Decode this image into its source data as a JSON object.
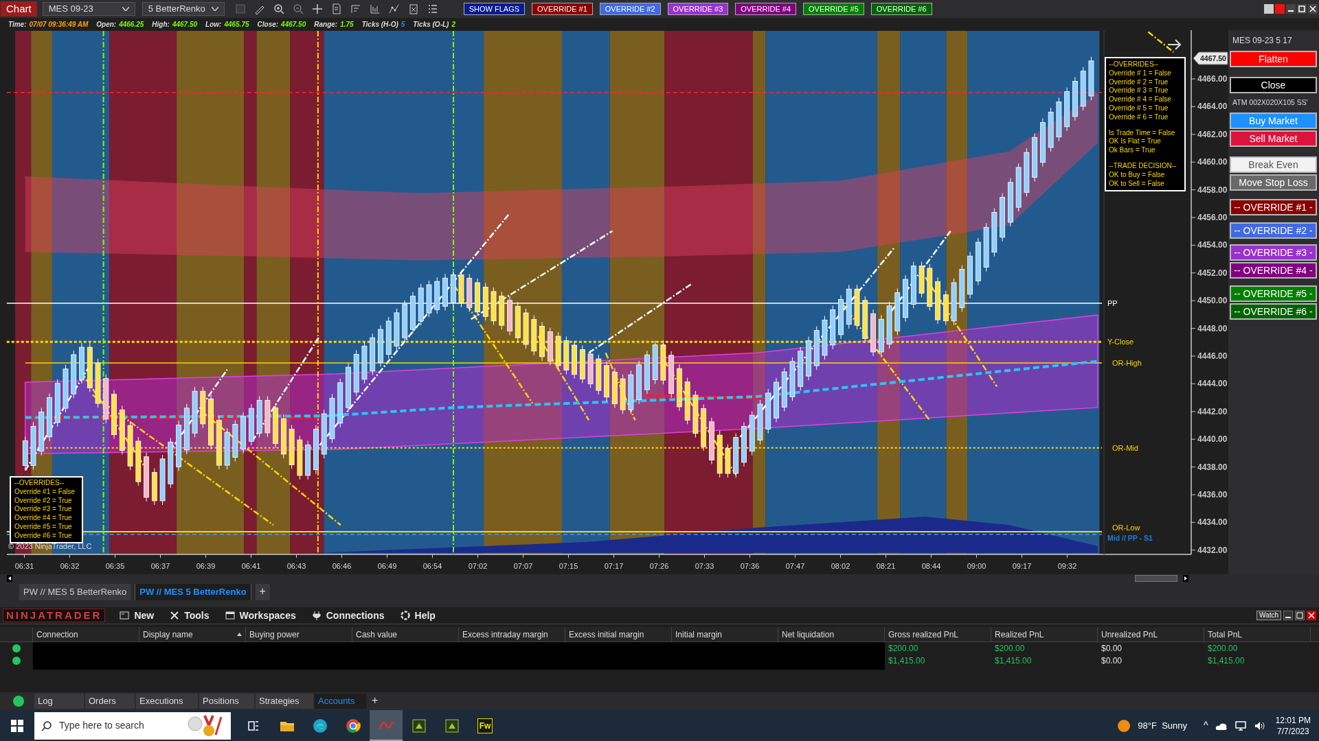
{
  "toolbar": {
    "chart_button": "Chart",
    "instrument": "MES 09-23",
    "bar_type": "5 BetterRenko",
    "flag_buttons": [
      {
        "label": "SHOW FLAGS",
        "color": "#0b1a8f"
      },
      {
        "label": "OVERRIDE #1",
        "color": "#8b0000"
      },
      {
        "label": "OVERRIDE #2",
        "color": "#4169e1"
      },
      {
        "label": "OVERRIDE #3",
        "color": "#9932cc"
      },
      {
        "label": "OVERRIDE #4",
        "color": "#800080"
      },
      {
        "label": "OVERRIDE #5",
        "color": "#008000"
      },
      {
        "label": "OVERRIDE #6",
        "color": "#006400"
      }
    ]
  },
  "data_line": [
    {
      "label": "Time:",
      "value": "07/07 09:36:49 AM",
      "color": "#ffa500"
    },
    {
      "label": "Open:",
      "value": "4466.25",
      "color": "#7cfc00"
    },
    {
      "label": "High:",
      "value": "4467.50",
      "color": "#7cfc00"
    },
    {
      "label": "Low:",
      "value": "4465.75",
      "color": "#7cfc00"
    },
    {
      "label": "Close:",
      "value": "4467.50",
      "color": "#7cfc00"
    },
    {
      "label": "Range:",
      "value": "1.75",
      "color": "#7cfc00"
    },
    {
      "label": "Ticks (H-O)",
      "value": "5",
      "color": "#1e90ff"
    },
    {
      "label": "Ticks (O-L)",
      "value": "2",
      "color": "#7cfc00"
    }
  ],
  "chart": {
    "price_ticks": [
      "4466.00",
      "4464.00",
      "4462.00",
      "4460.00",
      "4458.00",
      "4456.00",
      "4454.00",
      "4452.00",
      "4450.00",
      "4448.00",
      "4446.00",
      "4444.00",
      "4442.00",
      "4440.00",
      "4438.00",
      "4436.00",
      "4434.00",
      "4432.00"
    ],
    "current_price": "4467.50",
    "time_ticks": [
      "06:31",
      "06:32",
      "06:35",
      "06:37",
      "06:39",
      "06:41",
      "06:43",
      "06:46",
      "06:49",
      "06:54",
      "07:02",
      "07:07",
      "07:15",
      "07:17",
      "07:26",
      "07:33",
      "07:36",
      "07:47",
      "08:02",
      "08:21",
      "08:44",
      "09:00",
      "09:17",
      "09:32"
    ],
    "level_labels": [
      {
        "text": "PP",
        "color": "#ffffff"
      },
      {
        "text": "Y-Close",
        "color": "#ffd700"
      },
      {
        "text": "OR-High",
        "color": "#ffd700"
      },
      {
        "text": "OR-Mid",
        "color": "#ffd700"
      },
      {
        "text": "OR-Low",
        "color": "#ffd700"
      },
      {
        "text": "Mid // PP - S1",
        "color": "#1e7ee0"
      }
    ],
    "overrides_panel": [
      {
        "lines": [
          "--OVERRIDES--",
          "Override # 1  = False",
          "Override # 2  = True",
          "Override # 3  = True",
          "Override # 4  = False",
          "Override # 5  = True",
          "Override # 6  = True"
        ]
      },
      {
        "lines": [
          "Is Trade Time = False",
          "OK Is Flat = True",
          "Ok Bars = True"
        ]
      },
      {
        "lines": [
          "--TRADE DECISION--",
          "OK to Buy = False",
          "OK to Sell = False"
        ]
      }
    ],
    "overrides_legend": [
      "--OVERRIDES--",
      "Override #1 = False",
      "Override #2 = True",
      "Override #3 = True",
      "Override #4 = True",
      "Override #5 = True",
      "Override #6 = True"
    ],
    "copyright": "© 2023 NinjaTrader, LLC"
  },
  "side_panel": {
    "title": "MES 09-23 5 17",
    "buttons": [
      {
        "label": "Flatten",
        "color": "#ff0000",
        "kind": "button"
      },
      {
        "label": "Close",
        "color": "#000000",
        "kind": "button"
      },
      {
        "label": "ATM  002X020X105 SS'",
        "kind": "text"
      },
      {
        "label": "Buy Market",
        "color": "#1e90ff",
        "kind": "button"
      },
      {
        "label": "Sell Market",
        "color": "#dc143c",
        "kind": "button"
      },
      {
        "label": "Break Even",
        "color": "#f2f2f2",
        "kind": "button"
      },
      {
        "label": "Move Stop Loss",
        "color": "#696969",
        "kind": "button"
      },
      {
        "label": "-- OVERRIDE #1 -",
        "color": "#8b0000",
        "kind": "button"
      },
      {
        "label": "-- OVERRIDE #2 -",
        "color": "#4169e1",
        "kind": "button"
      },
      {
        "label": "-- OVERRIDE #3 -",
        "color": "#9932cc",
        "kind": "button"
      },
      {
        "label": "-- OVERRIDE #4 -",
        "color": "#800080",
        "kind": "button"
      },
      {
        "label": "-- OVERRIDE #5 -",
        "color": "#008000",
        "kind": "button"
      },
      {
        "label": "-- OVERRIDE #6 -",
        "color": "#006400",
        "kind": "button"
      }
    ]
  },
  "chart_tabs": [
    {
      "label": "PW // MES  5 BetterRenko",
      "selected": false
    },
    {
      "label": "PW // MES  5 BetterRenko",
      "selected": true
    }
  ],
  "add_tab": "+",
  "control_center": {
    "logo": "NINJATRADER",
    "menu": [
      {
        "label": "New",
        "kind": "new"
      },
      {
        "label": "Tools",
        "kind": "tools"
      },
      {
        "label": "Workspaces",
        "kind": "workspaces"
      },
      {
        "label": "Connections",
        "kind": "connections"
      },
      {
        "label": "Help",
        "kind": "help"
      }
    ],
    "watch_button": "Watch"
  },
  "accounts_table": {
    "columns": [
      {
        "label": "Connection",
        "sorted": false
      },
      {
        "label": "Display name",
        "sorted": true
      },
      {
        "label": "Buying power",
        "sorted": false
      },
      {
        "label": "Cash value",
        "sorted": false
      },
      {
        "label": "Excess intraday margin",
        "sorted": false
      },
      {
        "label": "Excess initial margin",
        "sorted": false
      },
      {
        "label": "Initial margin",
        "sorted": false
      },
      {
        "label": "Net liquidation",
        "sorted": false
      },
      {
        "label": "Gross realized PnL",
        "sorted": false
      },
      {
        "label": "Realized PnL",
        "sorted": false
      },
      {
        "label": "Unrealized PnL",
        "sorted": false
      },
      {
        "label": "Total PnL",
        "sorted": false
      }
    ],
    "rows": [
      {
        "color": "#22c55e",
        "cells": [
          {
            "text": "$200.00",
            "color": "#22c55e"
          },
          {
            "text": "$200.00",
            "color": "#22c55e"
          },
          {
            "text": "$0.00",
            "color": "#e5e5e5"
          },
          {
            "text": "$200.00",
            "color": "#22c55e"
          }
        ]
      },
      {
        "color": "#22c55e",
        "cells": [
          {
            "text": "$1,415.00",
            "color": "#22c55e"
          },
          {
            "text": "$1,415.00",
            "color": "#22c55e"
          },
          {
            "text": "$0.00",
            "color": "#e5e5e5"
          },
          {
            "text": "$1,415.00",
            "color": "#22c55e"
          }
        ]
      }
    ]
  },
  "bottom_tabs": {
    "color": "#22c55e",
    "tabs": [
      {
        "label": "Log",
        "selected": false
      },
      {
        "label": "Orders",
        "selected": false
      },
      {
        "label": "Executions",
        "selected": false
      },
      {
        "label": "Positions",
        "selected": false
      },
      {
        "label": "Strategies",
        "selected": false
      },
      {
        "label": "Accounts",
        "selected": true
      }
    ],
    "add": "+"
  },
  "taskbar": {
    "search_placeholder": "Type here to search",
    "apps": [
      {
        "kind": "taskview",
        "selected": false
      },
      {
        "kind": "explorer",
        "selected": false
      },
      {
        "kind": "edge",
        "selected": false
      },
      {
        "kind": "chrome",
        "selected": false
      },
      {
        "kind": "ninja",
        "selected": true
      },
      {
        "kind": "green",
        "selected": false
      },
      {
        "kind": "green",
        "selected": false
      },
      {
        "kind": "fw",
        "label": "Fw",
        "selected": false
      }
    ],
    "weather": "98°F  Sunny",
    "tray_caret": "^",
    "time": "12:01 PM",
    "date": "7/7/2023"
  }
}
